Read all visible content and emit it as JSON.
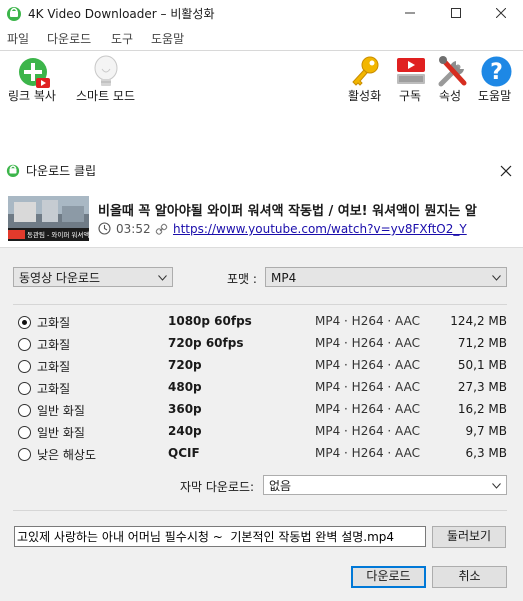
{
  "window": {
    "title": "4K Video Downloader – 비활성화",
    "controls": {
      "minimize": "minimize",
      "maximize": "maximize",
      "close": "close"
    }
  },
  "menu": [
    "파일",
    "다운로드",
    "도구",
    "도움말"
  ],
  "toolbar": {
    "paste_link": "링크 복사",
    "smart_mode": "스마트 모드",
    "activate": "활성화",
    "subscribe": "구독",
    "preferences": "속성",
    "help": "도움말"
  },
  "dialog": {
    "title": "다운로드 클립",
    "video": {
      "title": "비올때 꼭 알아야될 와이퍼 워셔액 작동법 / 여보! 워셔액이 뭔지는 알",
      "duration": "03:52",
      "url": "https://www.youtube.com/watch?v=yv8FXftO2_Y",
      "thumbnail_caption": "동관팀 - 와이퍼 워셔액 작동법"
    },
    "download_type": "동영상 다운로드",
    "format_label": "포맷 :",
    "format_value": "MP4",
    "qualities": [
      {
        "label": "고화질",
        "resolution": "1080p 60fps",
        "codec": "MP4 · H264 · AAC",
        "size": "124,2 MB",
        "selected": true
      },
      {
        "label": "고화질",
        "resolution": "720p 60fps",
        "codec": "MP4 · H264 · AAC",
        "size": "71,2 MB",
        "selected": false
      },
      {
        "label": "고화질",
        "resolution": "720p",
        "codec": "MP4 · H264 · AAC",
        "size": "50,1 MB",
        "selected": false
      },
      {
        "label": "고화질",
        "resolution": "480p",
        "codec": "MP4 · H264 · AAC",
        "size": "27,3 MB",
        "selected": false
      },
      {
        "label": "일반 화질",
        "resolution": "360p",
        "codec": "MP4 · H264 · AAC",
        "size": "16,2 MB",
        "selected": false
      },
      {
        "label": "일반 화질",
        "resolution": "240p",
        "codec": "MP4 · H264 · AAC",
        "size": "9,7 MB",
        "selected": false
      },
      {
        "label": "낮은 해상도",
        "resolution": "QCIF",
        "codec": "MP4 · H264 · AAC",
        "size": "6,3 MB",
        "selected": false
      }
    ],
    "subtitles_label": "자막 다운로드:",
    "subtitles_value": "없음",
    "filename": "고있제 사랑하는 아내 어머님 필수시청 ~  기본적인 작동법 완벽 설명.mp4",
    "browse_label": "둘러보기",
    "download_label": "다운로드",
    "cancel_label": "취소"
  },
  "colors": {
    "accent": "#0078d7",
    "link": "#1a0dab",
    "green": "#3cb54a"
  }
}
